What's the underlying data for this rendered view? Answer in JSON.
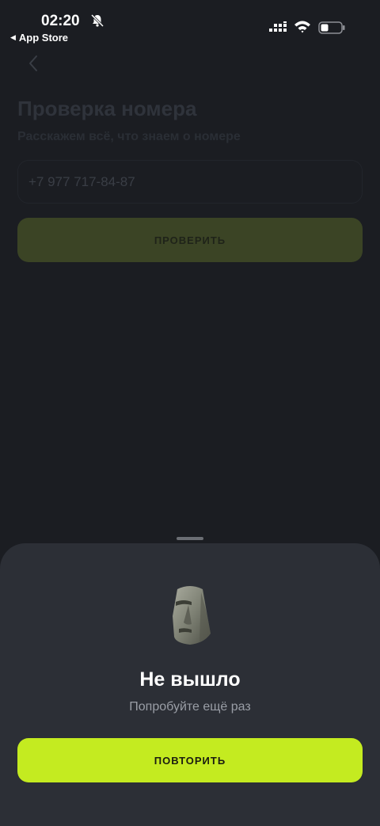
{
  "status_bar": {
    "time": "02:20",
    "back_app_label": "App Store"
  },
  "page": {
    "title": "Проверка номера",
    "subtitle": "Расскажем всё, что знаем о номере",
    "phone_input_value": "+7 977 717-84-87",
    "check_button_label": "ПРОВЕРИТЬ"
  },
  "sheet": {
    "icon": "moai-icon",
    "title": "Не вышло",
    "subtitle": "Попробуйте ещё раз",
    "retry_button_label": "ПОВТОРИТЬ"
  },
  "colors": {
    "accent": "#c4eb20",
    "background": "#1b1d22",
    "sheet_background": "#2c2f36"
  }
}
